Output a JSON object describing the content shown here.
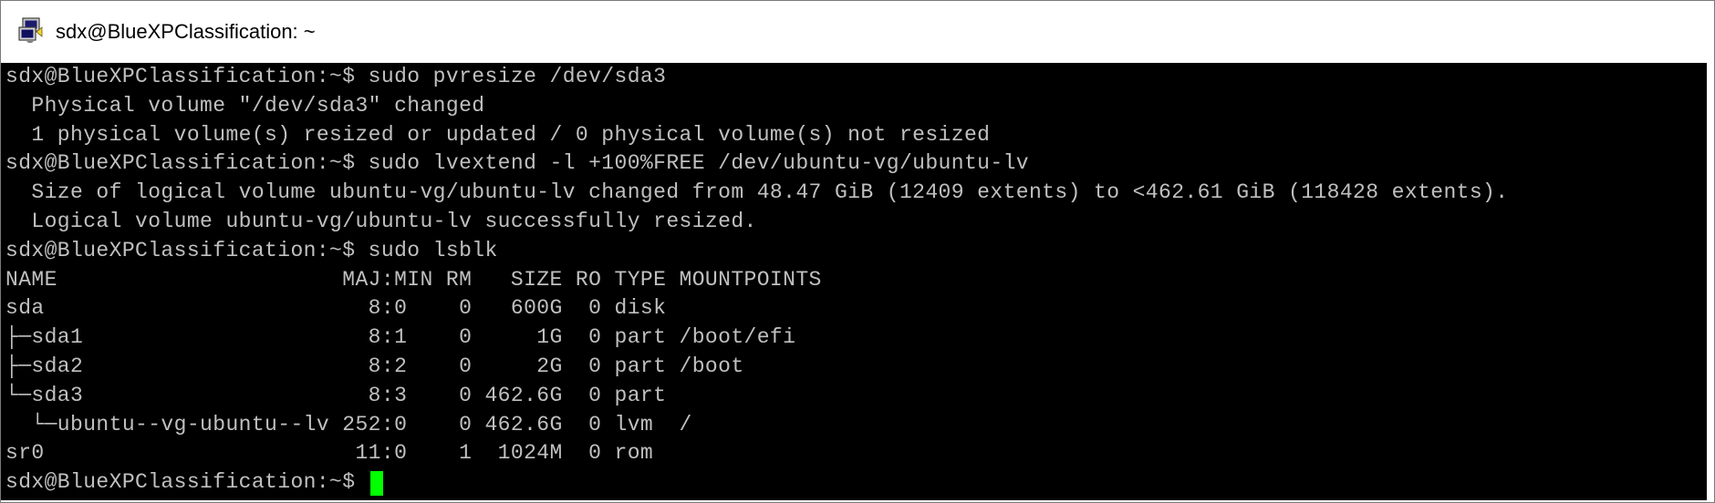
{
  "window": {
    "title": "sdx@BlueXPClassification: ~",
    "icon": "putty-terminal-icon"
  },
  "terminal": {
    "colors": {
      "background": "#000000",
      "foreground": "#c0c0c0",
      "cursor": "#00ff00"
    },
    "lines": [
      "sdx@BlueXPClassification:~$ sudo pvresize /dev/sda3",
      "  Physical volume \"/dev/sda3\" changed",
      "  1 physical volume(s) resized or updated / 0 physical volume(s) not resized",
      "sdx@BlueXPClassification:~$ sudo lvextend -l +100%FREE /dev/ubuntu-vg/ubuntu-lv",
      "  Size of logical volume ubuntu-vg/ubuntu-lv changed from 48.47 GiB (12409 extents) to <462.61 GiB (118428 extents).",
      "  Logical volume ubuntu-vg/ubuntu-lv successfully resized.",
      "sdx@BlueXPClassification:~$ sudo lsblk",
      "NAME                      MAJ:MIN RM   SIZE RO TYPE MOUNTPOINTS",
      "sda                         8:0    0   600G  0 disk",
      "├─sda1                      8:1    0     1G  0 part /boot/efi",
      "├─sda2                      8:2    0     2G  0 part /boot",
      "└─sda3                      8:3    0 462.6G  0 part",
      "  └─ubuntu--vg-ubuntu--lv 252:0    0 462.6G  0 lvm  /",
      "sr0                        11:0    1  1024M  0 rom"
    ],
    "prompt": "sdx@BlueXPClassification:~$ "
  }
}
